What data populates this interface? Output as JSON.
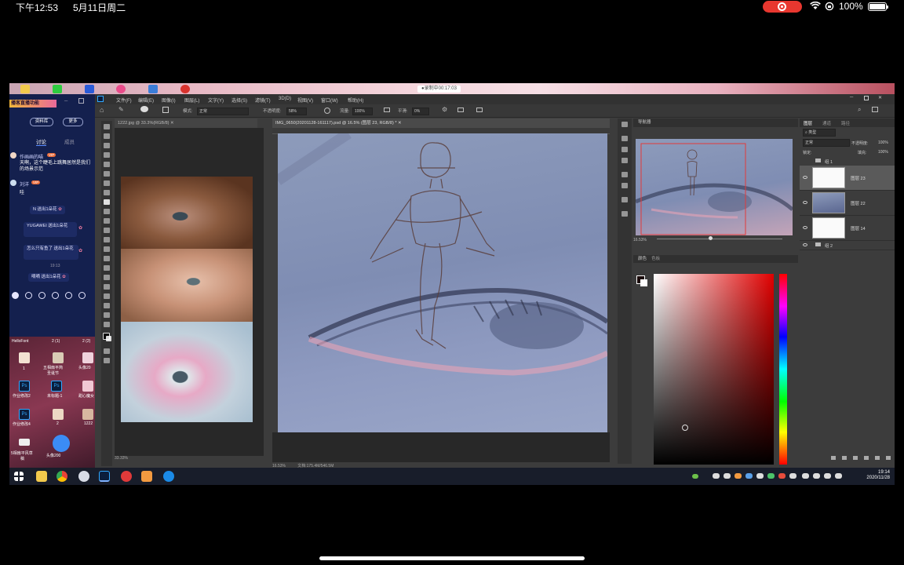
{
  "status_bar": {
    "time": "下午12:53",
    "date": "5月11日周二",
    "battery": "100%"
  },
  "recording_chip": "●录制中00:17:03",
  "chat": {
    "banner": "播客直播功能",
    "btn_materials": "资料库",
    "btn_more": "更多",
    "tab_discuss": "讨论",
    "tab_members": "成员",
    "msg1_user": "作画画的喵",
    "msg1_text": "天啊，这个睫毛上跳舞居然是我们的场景示范",
    "msg2_user": "刘洋",
    "msg2_text": "哇",
    "gift1": "N 送出1朵花",
    "gift2": "YUGAWEI 送出1朵花",
    "gift3": "怎么只有鱼了 送出1朵花",
    "time_divider": "19:13",
    "gift4": "嘀嘀 送出1朵花"
  },
  "desktop": {
    "header_left": "HelloFont",
    "header_mid": "2 (1)",
    "header_right": "2 (2)",
    "icon1": "1",
    "icon2": "五相扇平简",
    "icon2b": "圣诞节",
    "icon3": "头像20",
    "icon4": "作业修改2",
    "icon5": "未标题-1",
    "icon6": "甜心魔女",
    "icon7": "作业修改4",
    "icon8": "2",
    "icon9": "1222",
    "icon10": "5相扇平风草",
    "icon10b": "稿",
    "icon11": "头像200"
  },
  "photoshop": {
    "menu": [
      "文件(F)",
      "编辑(E)",
      "图像(I)",
      "图层(L)",
      "文字(Y)",
      "选择(S)",
      "滤镜(T)",
      "3D(D)",
      "视图(V)",
      "窗口(W)",
      "帮助(H)"
    ],
    "options": {
      "mode_label": "模式:",
      "mode_value": "正常",
      "opacity_label": "不透明度:",
      "opacity_value": "58%",
      "flow_label": "流量:",
      "flow_value": "100%",
      "smooth_label": "平滑:",
      "smooth_value": "0%"
    },
    "doc1": {
      "tab": "1222.jpg @ 33.3%(RGB/8)",
      "zoom": "33.33%"
    },
    "doc2": {
      "tab": "IMG_0650(20201128-161117).psd @ 16.5% (图层 23, RGB/8) *",
      "zoom": "16.53%",
      "info": "文档:175.4M/546.5M"
    },
    "navigator": {
      "tab": "导航器",
      "zoom": "16.53%"
    },
    "color": {
      "tab": "颜色",
      "tab2": "色板",
      "accent_red": "#e00000"
    },
    "layers": {
      "tab1": "图层",
      "tab2": "通道",
      "tab3": "路径",
      "filter": "类型",
      "blend": "正常",
      "opacity_label": "不透明度:",
      "opacity_value": "100%",
      "lock_label": "锁定:",
      "fill_label": "填充:",
      "fill_value": "100%",
      "group1": "组 1",
      "layer23": "图层 23",
      "layer22": "图层 22",
      "layer14": "图层 14",
      "group2": "组 2"
    }
  },
  "taskbar": {
    "time": "19:14",
    "date": "2020/11/28"
  }
}
